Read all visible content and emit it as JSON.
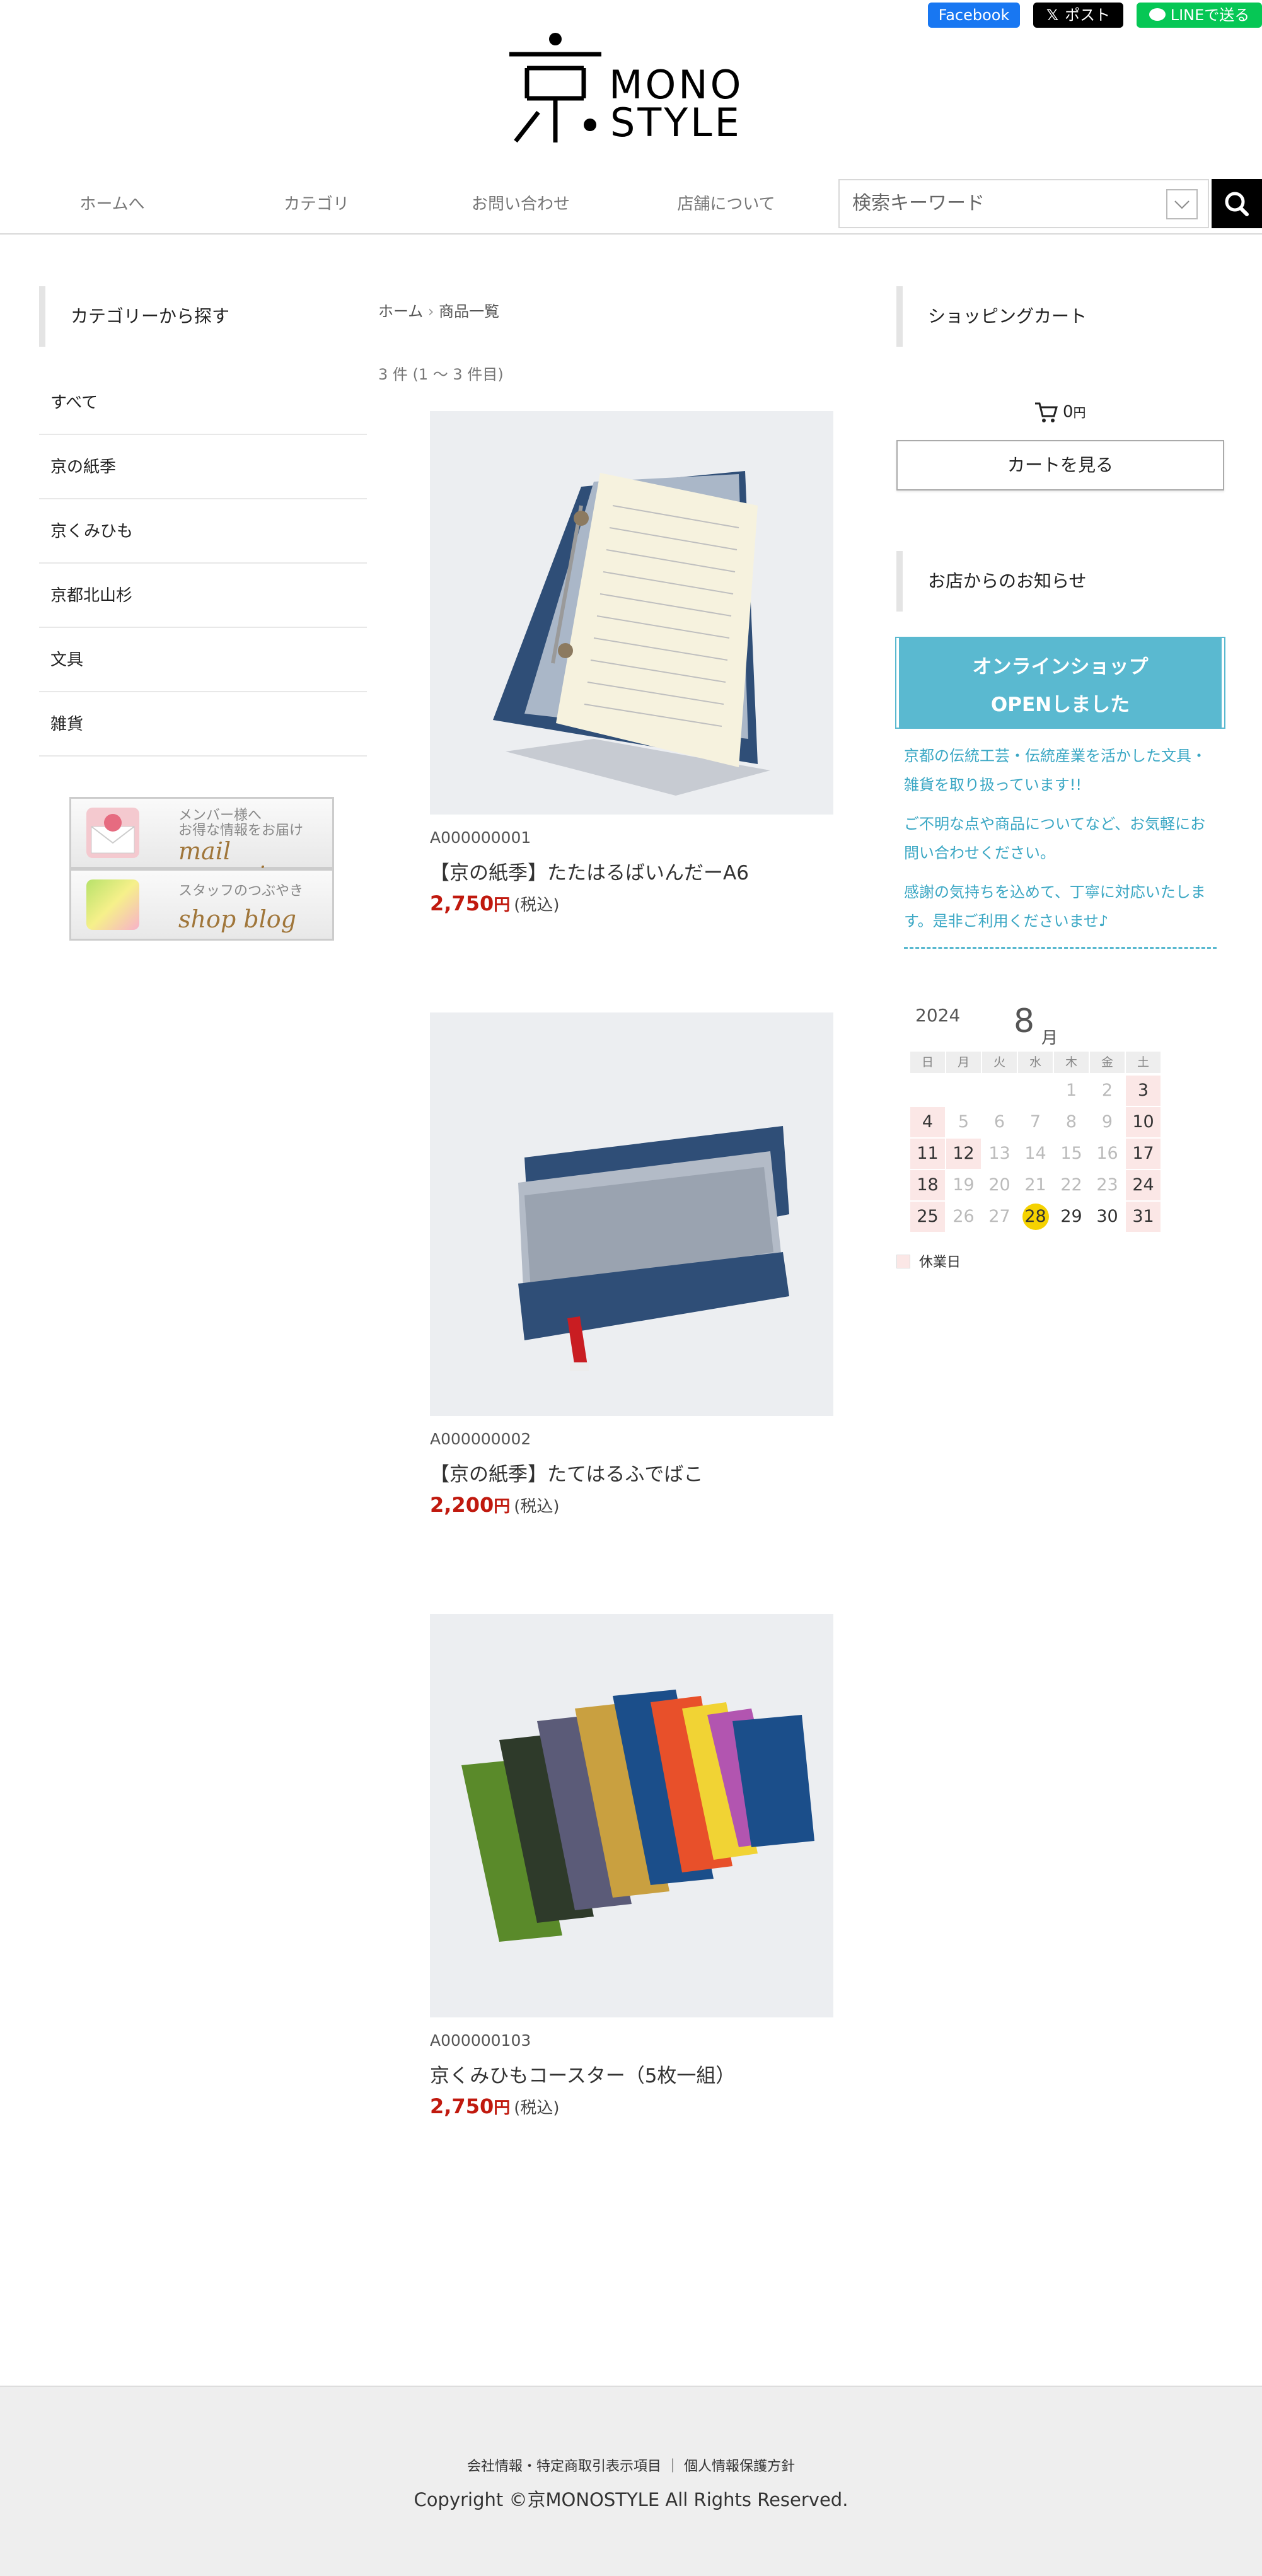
{
  "share": {
    "facebook_label": "Facebook",
    "x_label": "ポスト",
    "line_label": "LINEで送る"
  },
  "logo": {
    "kanji": "京",
    "line1": "MONO",
    "line2": "STYLE"
  },
  "nav": {
    "items": [
      "ホームへ",
      "カテゴリ",
      "お問い合わせ",
      "店舗について"
    ],
    "search_placeholder": "検索キーワード"
  },
  "sidebar": {
    "category_title": "カテゴリーから探す",
    "categories": [
      "すべて",
      "京の紙季",
      "京くみひも",
      "京都北山杉",
      "文具",
      "雑貨"
    ],
    "banners": [
      {
        "small1": "メンバー様へ",
        "small2": "お得な情報をお届け",
        "big": "mail magazine"
      },
      {
        "small1": "スタッフのつぶやき",
        "big": "shop blog"
      }
    ]
  },
  "breadcrumb": {
    "home": "ホーム",
    "separator": "›",
    "current": "商品一覧"
  },
  "result_count": "3 件 (1 ～ 3 件目)",
  "products": [
    {
      "code": "A000000001",
      "name": "【京の紙季】たたはるばいんだーA6",
      "price": "2,750",
      "yen": "円",
      "tax": "(税込)"
    },
    {
      "code": "A000000002",
      "name": "【京の紙季】たてはるふでばこ",
      "price": "2,200",
      "yen": "円",
      "tax": "(税込)"
    },
    {
      "code": "A000000103",
      "name": "京くみひもコースター（5枚一組）",
      "price": "2,750",
      "yen": "円",
      "tax": "(税込)"
    }
  ],
  "cart": {
    "title": "ショッピングカート",
    "amount": "0",
    "yen": "円",
    "view_button": "カートを見る"
  },
  "news": {
    "title": "お店からのお知らせ",
    "banner_line1": "オンラインショップ",
    "banner_line2": "OPENしました",
    "paragraphs": [
      "京都の伝統工芸・伝統産業を活かした文具・雑貨を取り扱っています!!",
      "ご不明な点や商品についてなど、お気軽にお問い合わせください。",
      "感謝の気持ちを込めて、丁寧に対応いたします。是非ご利用くださいませ♪"
    ]
  },
  "calendar": {
    "year": "2024",
    "month": "8",
    "month_unit": "月",
    "weekdays": [
      "日",
      "月",
      "火",
      "水",
      "木",
      "金",
      "土"
    ],
    "first_weekday_index": 4,
    "days_in_month": 31,
    "today": 28,
    "holidays": [
      3,
      4,
      10,
      11,
      12,
      17,
      18,
      24,
      25,
      31
    ],
    "legend": "休業日"
  },
  "footer": {
    "links_text": "会社情報・特定商取引表示項目 ｜ 個人情報保護方針",
    "copyright": "Copyright ©京MONOSTYLE All Rights Reserved."
  }
}
